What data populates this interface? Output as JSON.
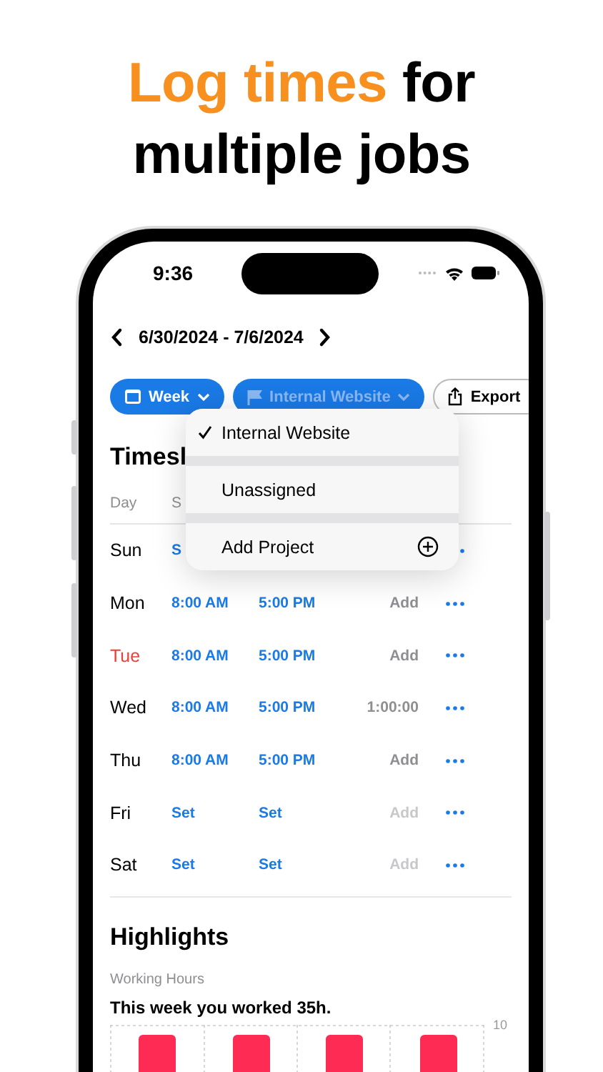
{
  "headline": {
    "accent": "Log times",
    "line1_rest": "for",
    "line2": "multiple jobs"
  },
  "status_bar": {
    "time": "9:36"
  },
  "date_range": {
    "label": "6/30/2024 - 7/6/2024"
  },
  "toolbar": [
    {
      "kind": "period",
      "label": "Week",
      "expanded": false
    },
    {
      "kind": "project",
      "label": "Internal Website",
      "expanded": true
    },
    {
      "kind": "export",
      "label": "Export"
    }
  ],
  "section_title": "Timesl",
  "columns": [
    "Day",
    "S"
  ],
  "rows": [
    {
      "day": "Sun",
      "today": false,
      "start": "S"
    },
    {
      "day": "Mon",
      "today": false,
      "start": "8:00 AM",
      "end": "5:00 PM",
      "hours": {
        "text": "Add",
        "disabled": false
      }
    },
    {
      "day": "Tue",
      "today": true,
      "start": "8:00 AM",
      "end": "5:00 PM",
      "hours": {
        "text": "Add",
        "disabled": false
      }
    },
    {
      "day": "Wed",
      "today": false,
      "start": "8:00 AM",
      "end": "5:00 PM",
      "hours": {
        "text": "1:00:00",
        "disabled": false
      }
    },
    {
      "day": "Thu",
      "today": false,
      "start": "8:00 AM",
      "end": "5:00 PM",
      "hours": {
        "text": "Add",
        "disabled": false
      }
    },
    {
      "day": "Fri",
      "today": false,
      "start": "Set",
      "end": "Set",
      "hours": {
        "text": "Add",
        "disabled": true
      }
    },
    {
      "day": "Sat",
      "today": false,
      "start": "Set",
      "end": "Set",
      "hours": {
        "text": "Add",
        "disabled": true
      }
    }
  ],
  "menu": {
    "items": [
      {
        "kind": "option",
        "label": "Internal Website",
        "selected": true
      },
      {
        "kind": "option",
        "label": "Unassigned",
        "selected": false
      },
      {
        "kind": "add",
        "label": "Add Project"
      }
    ]
  },
  "highlights": {
    "title": "Highlights",
    "caption": "Working Hours",
    "summary": "This week you worked 35h.",
    "y_tick": "10"
  }
}
